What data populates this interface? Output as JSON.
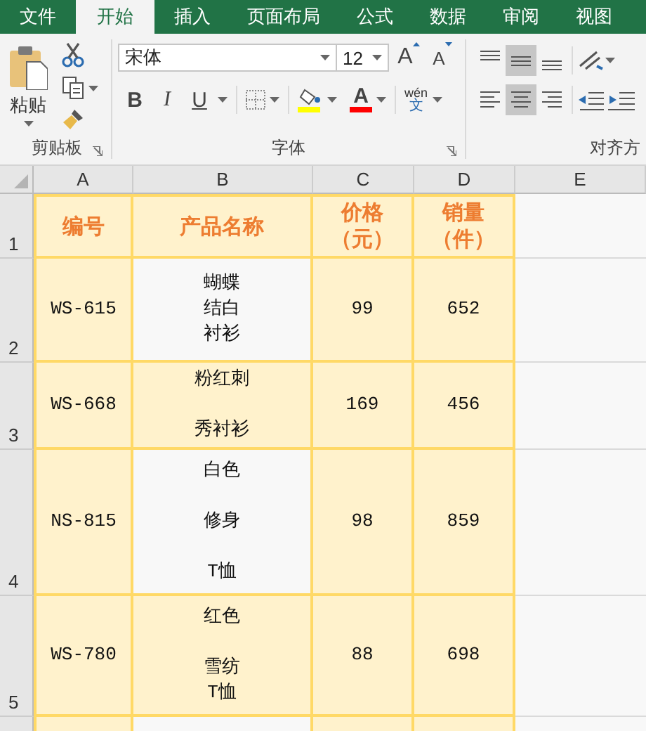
{
  "tabs": [
    {
      "label": "文件",
      "selected": false
    },
    {
      "label": "开始",
      "selected": true
    },
    {
      "label": "插入",
      "selected": false
    },
    {
      "label": "页面布局",
      "selected": false
    },
    {
      "label": "公式",
      "selected": false
    },
    {
      "label": "数据",
      "selected": false
    },
    {
      "label": "审阅",
      "selected": false
    },
    {
      "label": "视图",
      "selected": false
    }
  ],
  "ribbon": {
    "clipboard": {
      "paste_label": "粘贴",
      "group_label": "剪贴板"
    },
    "font": {
      "font_name": "宋体",
      "font_size": "12",
      "grow_label": "A",
      "shrink_label": "A",
      "bold_label": "B",
      "italic_label": "I",
      "underline_label": "U",
      "font_color_label": "A",
      "phonetic_top": "wén",
      "phonetic_bottom": "文",
      "group_label": "字体"
    },
    "alignment": {
      "group_label": "对齐方",
      "vertical": [
        {
          "kind": "top",
          "selected": false
        },
        {
          "kind": "middle",
          "selected": true
        },
        {
          "kind": "bottom",
          "selected": false
        }
      ],
      "horizontal": [
        {
          "kind": "left",
          "selected": false
        },
        {
          "kind": "center",
          "selected": true
        },
        {
          "kind": "right",
          "selected": false
        }
      ]
    }
  },
  "sheet": {
    "columns": [
      "A",
      "B",
      "C",
      "D",
      "E"
    ],
    "rows": [
      {
        "number": "1",
        "kind": "header",
        "cells": [
          {
            "paragraphs": [
              [
                "编号"
              ]
            ],
            "highlighted": true
          },
          {
            "paragraphs": [
              [
                "产品名称"
              ]
            ],
            "highlighted": true
          },
          {
            "paragraphs": [
              [
                "价格",
                "（元）"
              ]
            ],
            "highlighted": true
          },
          {
            "paragraphs": [
              [
                "销量",
                "（件）"
              ]
            ],
            "highlighted": true
          }
        ]
      },
      {
        "number": "2",
        "kind": "data",
        "cells": [
          {
            "paragraphs": [
              [
                "WS-615"
              ]
            ],
            "highlighted": true
          },
          {
            "paragraphs": [
              [
                "蝴蝶",
                "结白",
                "衬衫"
              ]
            ],
            "highlighted": false
          },
          {
            "paragraphs": [
              [
                "99"
              ]
            ],
            "highlighted": true
          },
          {
            "paragraphs": [
              [
                "652"
              ]
            ],
            "highlighted": true
          }
        ]
      },
      {
        "number": "3",
        "kind": "data",
        "cells": [
          {
            "paragraphs": [
              [
                "WS-668"
              ]
            ],
            "highlighted": true
          },
          {
            "paragraphs": [
              [
                "粉红刺"
              ],
              [
                "秀衬衫"
              ]
            ],
            "highlighted": true
          },
          {
            "paragraphs": [
              [
                "169"
              ]
            ],
            "highlighted": true
          },
          {
            "paragraphs": [
              [
                "456"
              ]
            ],
            "highlighted": true
          }
        ]
      },
      {
        "number": "4",
        "kind": "data",
        "cells": [
          {
            "paragraphs": [
              [
                "NS-815"
              ]
            ],
            "highlighted": true
          },
          {
            "paragraphs": [
              [
                "白色"
              ],
              [
                "修身"
              ],
              [
                "T恤"
              ]
            ],
            "highlighted": false
          },
          {
            "paragraphs": [
              [
                "98"
              ]
            ],
            "highlighted": true
          },
          {
            "paragraphs": [
              [
                "859"
              ]
            ],
            "highlighted": true
          }
        ]
      },
      {
        "number": "5",
        "kind": "data",
        "cells": [
          {
            "paragraphs": [
              [
                "WS-780"
              ]
            ],
            "highlighted": true
          },
          {
            "paragraphs": [
              [
                "红色"
              ],
              [
                "雪纺",
                "T恤"
              ]
            ],
            "highlighted": true
          },
          {
            "paragraphs": [
              [
                "88"
              ]
            ],
            "highlighted": true
          },
          {
            "paragraphs": [
              [
                "698"
              ]
            ],
            "highlighted": true
          }
        ]
      },
      {
        "kind": "data",
        "cells": [
          {
            "highlighted": true
          },
          {
            "highlighted": false
          },
          {
            "highlighted": true
          },
          {
            "highlighted": true
          }
        ]
      }
    ]
  }
}
